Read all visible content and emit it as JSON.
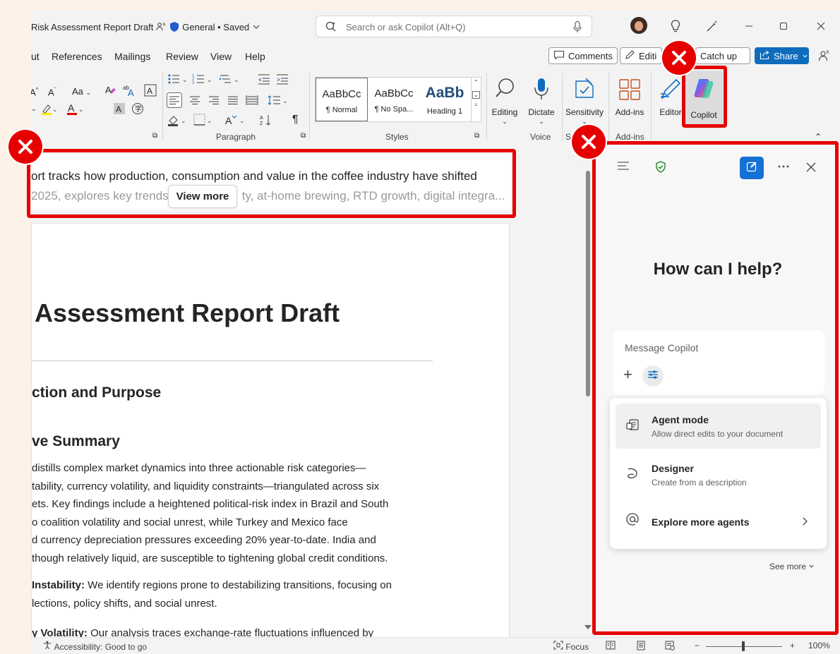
{
  "titlebar": {
    "doc_title": "Risk Assessment Report Draft",
    "sensitivity": "General",
    "saved": "• Saved",
    "search_placeholder": "Search or ask Copilot (Alt+Q)"
  },
  "menu": {
    "items": [
      "ut",
      "References",
      "Mailings",
      "Review",
      "View",
      "Help"
    ],
    "comments": "Comments",
    "editing": "Editi",
    "catchup": "Catch up",
    "share": "Share"
  },
  "ribbon": {
    "font_case": "Aa",
    "paragraph_label": "Paragraph",
    "styles_label": "Styles",
    "styles": [
      {
        "preview": "AaBbCc",
        "name": "¶ Normal"
      },
      {
        "preview": "AaBbCc",
        "name": "¶ No Spa..."
      },
      {
        "preview": "AaBb",
        "name": "Heading 1"
      }
    ],
    "editing": "Editing",
    "dictate": "Dictate",
    "voice_label": "Voice",
    "sensitivity": "Sensitivity",
    "sensitivity_group_label": "S",
    "addins": "Add-ins",
    "addins_label": "Add-ins",
    "editor": "Editor",
    "copilot": "Copilot"
  },
  "banner": {
    "line1": "ort tracks how production, consumption and value in the coffee industry have shifted",
    "line2": " 2025, explores key trends",
    "line2_cont": "ty, at-home brewing, RTD growth, digital integra...",
    "view_more": "View more"
  },
  "document": {
    "title": "Assessment Report Draft",
    "section1": "ction and Purpose",
    "section2": "ve Summary",
    "para1": [
      "distills complex market dynamics into three actionable risk categories—",
      "tability, currency volatility, and liquidity constraints—triangulated across six",
      "ets. Key findings include a heightened political-risk index in Brazil and South",
      "o coalition volatility and social unrest, while Turkey and Mexico face",
      "d currency depreciation pressures exceeding 20% year-to-date. India and",
      "though relatively liquid, are susceptible to tightening global credit conditions."
    ],
    "bullet1_bold": " Instability:",
    "bullet1_text": " We identify regions prone to destabilizing transitions, focusing on",
    "bullet1_line2": "lections, policy shifts, and social unrest.",
    "bullet2_bold": "y Volatility:",
    "bullet2_text": " Our analysis traces exchange-rate fluctuations influenced by"
  },
  "copilot": {
    "heading": "How can I help?",
    "message_placeholder": "Message Copilot",
    "menu": [
      {
        "title": "Agent mode",
        "subtitle": "Allow direct edits to your document"
      },
      {
        "title": "Designer",
        "subtitle": "Create from a description"
      },
      {
        "title": "Explore more agents",
        "subtitle": ""
      }
    ],
    "see_more": "See more"
  },
  "status": {
    "accessibility": "Accessibility: Good to go",
    "focus": "Focus",
    "zoom": "100%",
    "zoom_minus": "−",
    "zoom_plus": "+"
  },
  "colors": {
    "accent": "#0f6cbd",
    "annotation_red": "#e60000",
    "background": "#fdf1e8"
  }
}
